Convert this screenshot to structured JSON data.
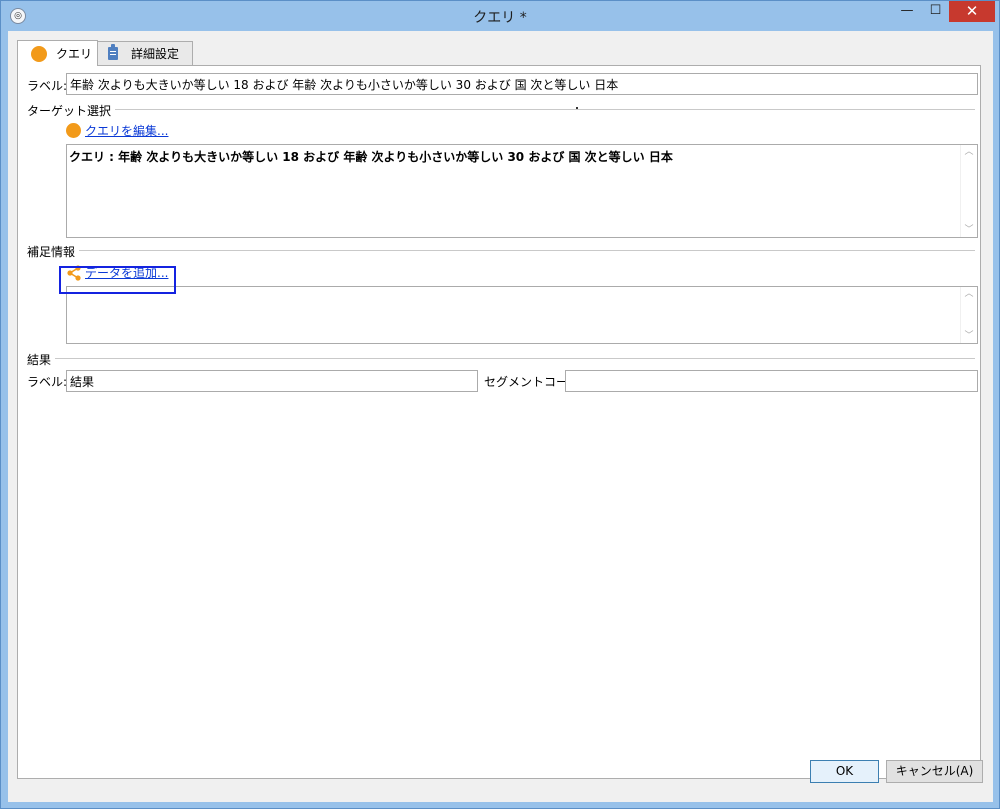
{
  "window": {
    "title": "クエリ *",
    "app_icon": "app-icon",
    "controls": {
      "minimize": "—",
      "maximize": "☐",
      "close": "✕"
    }
  },
  "tabs": [
    {
      "label": "クエリ",
      "icon": "orange-circle-icon",
      "active": true
    },
    {
      "label": "詳細設定",
      "icon": "clipboard-icon",
      "active": false
    }
  ],
  "form": {
    "label_caption": "ラベル:",
    "label_value": "年齢 次よりも大きいか等しい 18 および 年齢 次よりも小さいか等しい 30 および 国 次と等しい 日本",
    "target": {
      "section_title": "ターゲット選択",
      "edit_link": "クエリを編集...",
      "query_text": "クエリ : 年齢 次よりも大きいか等しい 18 および 年齢 次よりも小さいか等しい 30 および 国 次と等しい 日本"
    },
    "additional": {
      "section_title": "補足情報",
      "add_link": "データを追加..."
    },
    "result": {
      "section_title": "結果",
      "label_caption": "ラベル:",
      "label_value": "結果",
      "segment_caption": "セグメントコード:",
      "segment_value": ""
    }
  },
  "buttons": {
    "ok": "OK",
    "cancel": "キャンセル(A)"
  },
  "colors": {
    "accent_orange": "#f29a1a",
    "link_blue": "#0a39d6",
    "highlight_box": "#1423e0",
    "close_red": "#c7392e"
  }
}
